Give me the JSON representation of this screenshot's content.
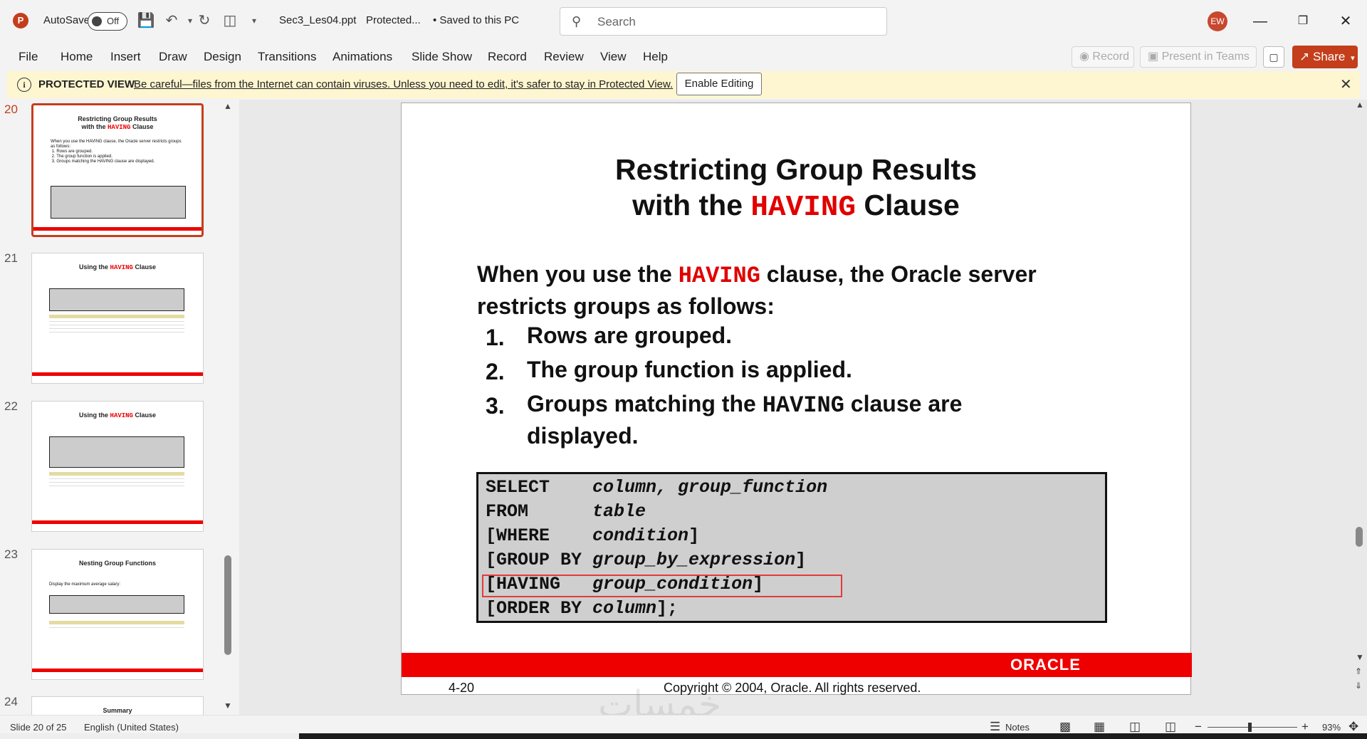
{
  "app": {
    "autosave_label": "AutoSave",
    "autosave_state": "Off",
    "filename": "Sec3_Les04.ppt",
    "mode": "Protected...",
    "save_status": "• Saved to this PC",
    "search_placeholder": "Search",
    "user_initials": "EW"
  },
  "ribbon": {
    "tabs": [
      "File",
      "Home",
      "Insert",
      "Draw",
      "Design",
      "Transitions",
      "Animations",
      "Slide Show",
      "Record",
      "Review",
      "View",
      "Help"
    ],
    "record_label": "Record",
    "present_label": "Present in Teams",
    "share_label": "Share"
  },
  "protected": {
    "heading": "PROTECTED VIEW",
    "message": "Be careful—files from the Internet can contain viruses. Unless you need to edit, it's safer to stay in Protected View.",
    "enable_label": "Enable Editing"
  },
  "thumbnails": [
    {
      "num": "20",
      "title_line1": "Restricting Group Results",
      "title_pre": "with the ",
      "title_kw": "HAVING",
      "title_post": " Clause"
    },
    {
      "num": "21",
      "title_pre": "Using the ",
      "title_kw": "HAVING",
      "title_post": " Clause"
    },
    {
      "num": "22",
      "title_pre": "Using the ",
      "title_kw": "HAVING",
      "title_post": " Clause"
    },
    {
      "num": "23",
      "title": "Nesting Group Functions",
      "text": "Display the maximum average salary:"
    },
    {
      "num": "24",
      "title": "Summary"
    }
  ],
  "slide": {
    "title_line1": "Restricting Group Results",
    "title_line2_pre": "with the ",
    "title_keyword": "HAVING",
    "title_line2_post": " Clause",
    "intro_pre": "When you use the ",
    "intro_keyword": "HAVING",
    "intro_post": " clause, the Oracle server",
    "intro_line2": "restricts groups as follows:",
    "steps": [
      {
        "num": "1.",
        "text": "Rows are grouped."
      },
      {
        "num": "2.",
        "text": "The group function is applied."
      },
      {
        "num": "3.",
        "pre": "Groups matching the ",
        "kw": "HAVING",
        "post": " clause are",
        "line2": "displayed."
      }
    ],
    "code": [
      {
        "kw": "SELECT    ",
        "arg": "column, group_function",
        "tail": ""
      },
      {
        "kw": "FROM      ",
        "arg": "table",
        "tail": ""
      },
      {
        "kw": "[WHERE    ",
        "arg": "condition",
        "tail": "]"
      },
      {
        "kw": "[GROUP BY ",
        "arg": "group_by_expression",
        "tail": "]"
      },
      {
        "kw": "[HAVING   ",
        "arg": "group_condition",
        "tail": "]"
      },
      {
        "kw": "[ORDER BY ",
        "arg": "column",
        "tail": "];"
      }
    ],
    "logo_text": "ORACLE",
    "page_ref": "4-20",
    "copyright": "Copyright © 2004, Oracle.  All rights reserved."
  },
  "status": {
    "slide_info": "Slide 20 of 25",
    "language": "English (United States)",
    "notes_label": "Notes",
    "zoom": "93%"
  }
}
